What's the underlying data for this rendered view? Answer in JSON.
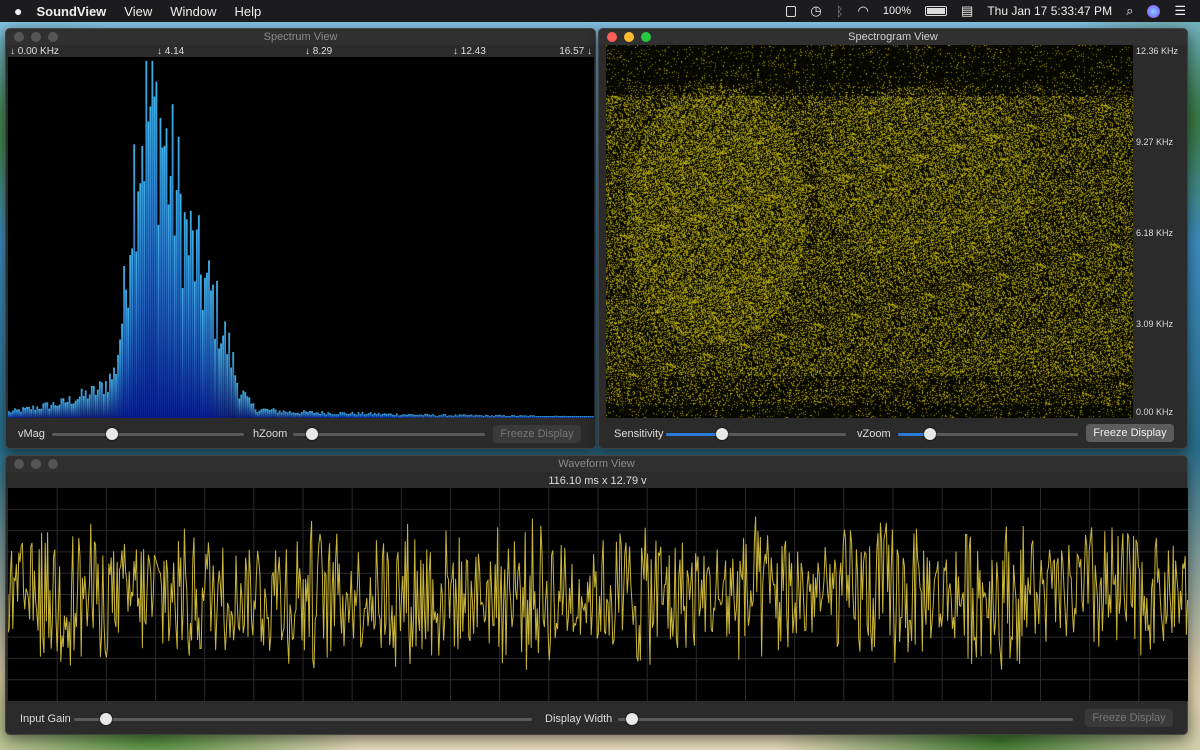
{
  "menubar": {
    "app_name": "SoundView",
    "menus": [
      "View",
      "Window",
      "Help"
    ],
    "battery": "100%",
    "clock": "Thu Jan 17  5:33:47 PM"
  },
  "spectrum": {
    "title": "Spectrum View",
    "freq_labels": [
      "↓ 0.00 KHz",
      "↓ 4.14",
      "↓ 8.29",
      "↓ 12.43",
      "16.57 ↓"
    ],
    "controls": {
      "vmag_label": "vMag",
      "hzoom_label": "hZoom",
      "freeze_label": "Freeze Display"
    },
    "vmag_level": 0.31,
    "hzoom_level": 0.1,
    "colors": {
      "bar_top": "#3fb0e6",
      "bar_bottom": "#0a1f8f",
      "background": "#000000"
    },
    "chart_data": {
      "type": "bar",
      "x_unit": "KHz",
      "xlim": [
        0,
        16.57
      ],
      "ylim": [
        0,
        1
      ],
      "envelope_points": [
        [
          0.0,
          0.02
        ],
        [
          0.5,
          0.03
        ],
        [
          1.0,
          0.04
        ],
        [
          1.5,
          0.05
        ],
        [
          2.0,
          0.07
        ],
        [
          2.5,
          0.09
        ],
        [
          2.8,
          0.12
        ],
        [
          3.0,
          0.15
        ],
        [
          3.3,
          0.42
        ],
        [
          3.5,
          0.78
        ],
        [
          3.8,
          0.97
        ],
        [
          4.0,
          1.0
        ],
        [
          4.3,
          0.95
        ],
        [
          4.5,
          0.83
        ],
        [
          4.8,
          0.72
        ],
        [
          5.0,
          0.6
        ],
        [
          5.3,
          0.52
        ],
        [
          5.5,
          0.45
        ],
        [
          5.8,
          0.38
        ],
        [
          6.0,
          0.3
        ],
        [
          6.3,
          0.2
        ],
        [
          6.5,
          0.1
        ],
        [
          6.8,
          0.05
        ],
        [
          7.0,
          0.03
        ],
        [
          8.0,
          0.02
        ],
        [
          10.0,
          0.015
        ],
        [
          12.0,
          0.01
        ],
        [
          14.0,
          0.008
        ],
        [
          16.57,
          0.005
        ]
      ]
    }
  },
  "spectrogram": {
    "title": "Spectrogram View",
    "axis_labels": [
      "12.36 KHz",
      "9.27 KHz",
      "6.18 KHz",
      "3.09 KHz",
      "0.00 KHz"
    ],
    "controls": {
      "sensitivity_label": "Sensitivity",
      "vzoom_label": "vZoom",
      "freeze_label": "Freeze Display"
    },
    "sensitivity_level": 0.31,
    "vzoom_level": 0.18,
    "colors": {
      "intensity": "#c9bd1a",
      "background": "#000000"
    }
  },
  "waveform": {
    "title": "Waveform View",
    "scale_readout": "116.10 ms x 12.79 v",
    "controls": {
      "input_gain_label": "Input Gain",
      "display_width_label": "Display Width",
      "freeze_label": "Freeze Display"
    },
    "input_gain_level": 0.07,
    "display_width_level": 0.03,
    "colors": {
      "trace": "#c9b53a",
      "grid": "#2a2a2a",
      "background": "#000000"
    }
  }
}
